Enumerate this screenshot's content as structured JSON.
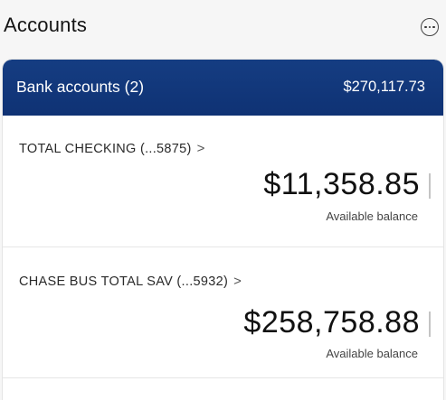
{
  "header": {
    "title": "Accounts",
    "more_icon": "more-options-icon"
  },
  "bank_accounts": {
    "title": "Bank accounts (2)",
    "total": "$270,117.73",
    "header_color": "#153d82",
    "accounts": [
      {
        "name": "TOTAL CHECKING (...5875)",
        "chevron": ">",
        "balance": "$11,358.85",
        "balance_label": "Available balance"
      },
      {
        "name": "CHASE BUS TOTAL SAV (...5932)",
        "chevron": ">",
        "balance": "$258,758.88",
        "balance_label": "Available balance"
      }
    ]
  }
}
